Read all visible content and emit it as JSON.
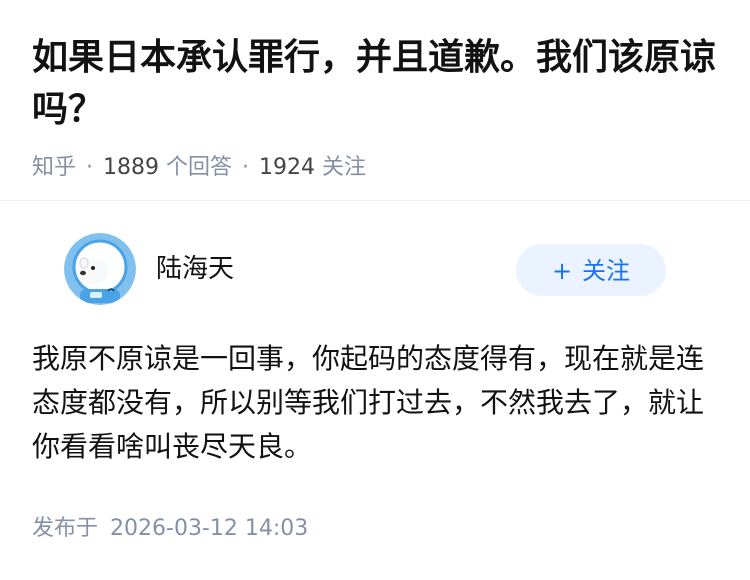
{
  "question": {
    "title": "如果日本承认罪行，并且道歉。我们该原谅吗？",
    "source": "知乎",
    "answer_count": "1889",
    "answer_label": "个回答",
    "follower_count": "1924",
    "follower_label": "关注",
    "separator": "·"
  },
  "answer": {
    "author_name": "陆海天",
    "follow_plus": "+",
    "follow_label": "关注",
    "content": "我原不原谅是一回事，你起码的态度得有，现在就是连态度都没有，所以别等我们打过去，不然我去了，就让你看看啥叫丧尽天良。",
    "published_label": "发布于",
    "published_date": "2026-03-12 14:03"
  },
  "icons": {
    "avatar": "polar-bear-astronaut-avatar"
  },
  "colors": {
    "accent": "#1772f6",
    "accent_bg": "#eaf3ff",
    "meta_text": "#8590a6",
    "primary_text": "#121212"
  }
}
